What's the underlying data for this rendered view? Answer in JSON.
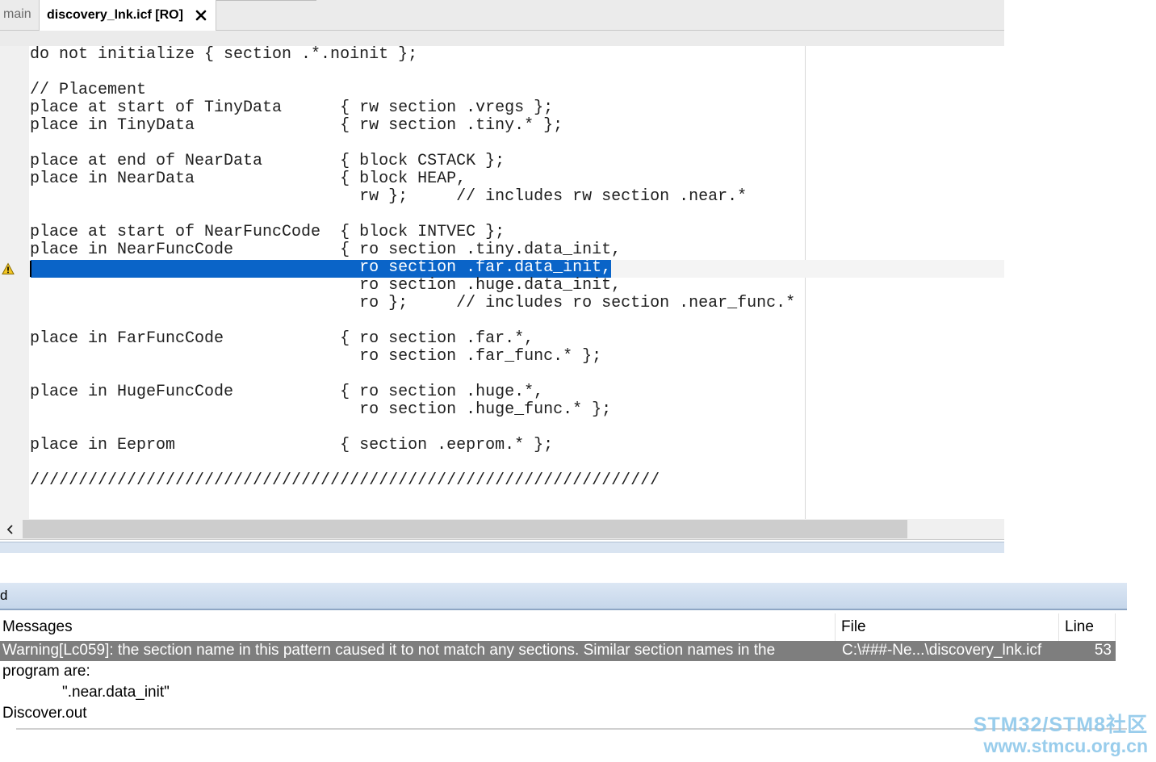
{
  "tabs": {
    "inactive_label": "main",
    "active_label": "discovery_lnk.icf [RO]"
  },
  "editor": {
    "highlighted_line": 12,
    "highlighted_text": "ro section .far.data_init,",
    "highlight_prefix": "                                  ",
    "lines": [
      "do not initialize { section .*.noinit };",
      "",
      "// Placement",
      "place at start of TinyData      { rw section .vregs };",
      "place in TinyData               { rw section .tiny.* };",
      "",
      "place at end of NearData        { block CSTACK };",
      "place in NearData               { block HEAP,",
      "                                  rw };     // includes rw section .near.*",
      "",
      "place at start of NearFuncCode  { block INTVEC };",
      "place in NearFuncCode           { ro section .tiny.data_init,",
      "",
      "                                  ro section .huge.data_init,",
      "                                  ro };     // includes ro section .near_func.*",
      "",
      "place in FarFuncCode            { ro section .far.*,",
      "                                  ro section .far_func.* };",
      "",
      "place in HugeFuncCode           { ro section .huge.*,",
      "                                  ro section .huge_func.* };",
      "",
      "place in Eeprom                 { section .eeprom.* };",
      "",
      "/////////////////////////////////////////////////////////////////"
    ]
  },
  "panel": {
    "title": "d",
    "columns": {
      "messages": "Messages",
      "file": "File",
      "line": "Line"
    },
    "message": {
      "line1": "Warning[Lc059]: the section name in this pattern caused it to not match any sections. Similar section names in the",
      "line2": "program are:",
      "line3": "\".near.data_init\"",
      "line4": "Discover.out",
      "file": "C:\\###-Ne...\\discovery_lnk.icf",
      "line": "53"
    }
  },
  "watermark": {
    "line1": "STM32/STM8社区",
    "line2": "www.stmcu.org.cn"
  },
  "colors": {
    "selection": "#0a64c8",
    "selected_row": "#7e7e7e",
    "warning": "#f3c623",
    "panel_header": "#c5d6ea"
  },
  "icons": [
    "close-icon",
    "warning-icon",
    "chevron-left-icon"
  ]
}
